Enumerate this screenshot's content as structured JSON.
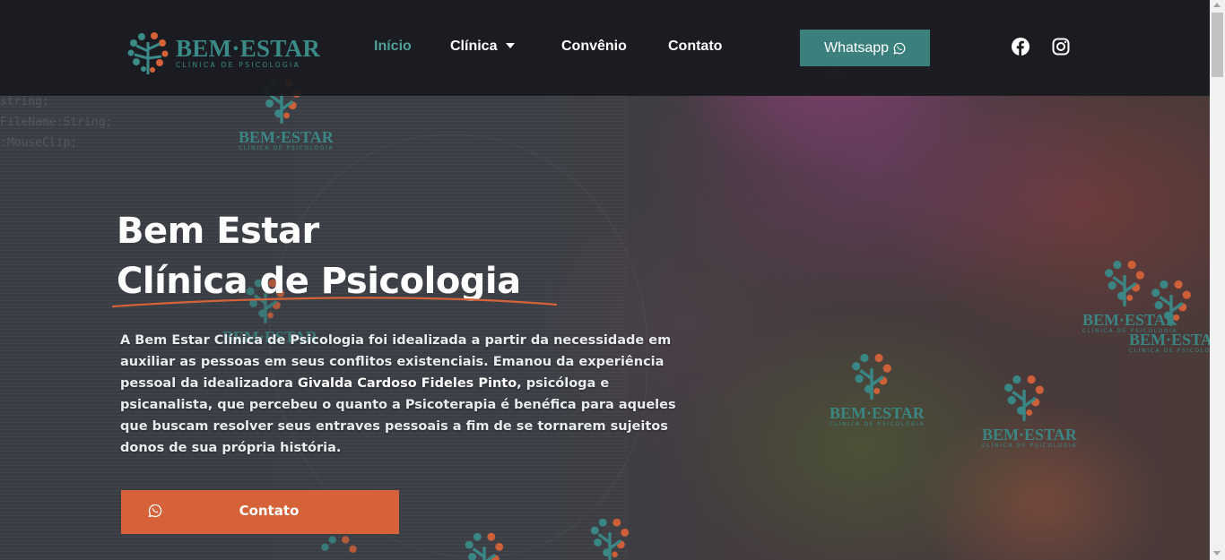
{
  "brand": {
    "name": "BEM·ESTAR",
    "tagline": "CLÍNICA DE PSICOLOGIA",
    "teal": "#3a8a88",
    "orange": "#d56238"
  },
  "nav": {
    "items": [
      {
        "label": "Início",
        "active": true
      },
      {
        "label": "Clínica",
        "has_dropdown": true
      },
      {
        "label": "Convênio"
      },
      {
        "label": "Contato"
      }
    ],
    "whatsapp_label": "Whatsapp",
    "social": [
      "facebook-icon",
      "instagram-icon"
    ]
  },
  "code_bg": [
    "    string;",
    "FileName:String;",
    ":MouseClip;"
  ],
  "hero": {
    "title_line1": "Bem Estar",
    "title_line2": "Clínica de Psicologia",
    "intro_part1": "A Bem Estar Clínica de Psicologia foi idealizada a partir da necessidade em auxiliar as pessoas em seus conflitos existenciais. Emanou da experiência pessoal da idealizadora ",
    "intro_name": "Givalda Cardoso Fideles Pinto",
    "intro_part2": ", psicóloga e psicanalista, que percebeu o quanto a Psicoterapia é benéfica para aqueles que buscam resolver seus entraves pessoais a fim de se tornarem sujeitos donos de sua própria história.",
    "cta_label": "Contato"
  },
  "watermarks": [
    {
      "title": "BEM·ESTAR",
      "sub": "CLÍNICA DE PSICOLOGIA"
    }
  ]
}
